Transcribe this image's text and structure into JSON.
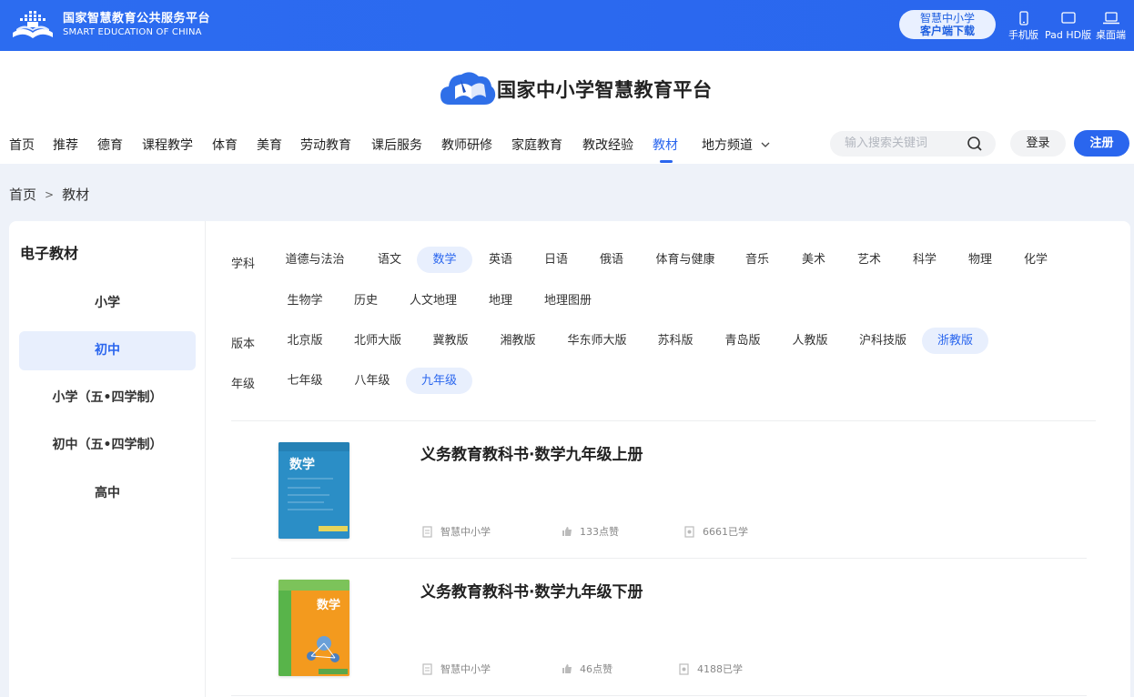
{
  "topbar": {
    "brand_cn": "国家智慧教育公共服务平台",
    "brand_en": "SMART EDUCATION OF CHINA",
    "download_line1": "智慧中小学",
    "download_line2": "客户端下载",
    "devices": [
      {
        "label": "手机版",
        "icon": "phone-icon"
      },
      {
        "label": "Pad HD版",
        "icon": "tablet-icon"
      },
      {
        "label": "桌面端",
        "icon": "laptop-icon"
      }
    ]
  },
  "header": {
    "platform_title": "国家中小学智慧教育平台"
  },
  "nav": {
    "items": [
      {
        "label": "首页"
      },
      {
        "label": "推荐"
      },
      {
        "label": "德育"
      },
      {
        "label": "课程教学"
      },
      {
        "label": "体育"
      },
      {
        "label": "美育"
      },
      {
        "label": "劳动教育"
      },
      {
        "label": "课后服务"
      },
      {
        "label": "教师研修"
      },
      {
        "label": "家庭教育"
      },
      {
        "label": "教改经验"
      },
      {
        "label": "教材"
      },
      {
        "label": "地方频道"
      }
    ],
    "active": "教材"
  },
  "search": {
    "placeholder": "输入搜索关键词"
  },
  "auth": {
    "login": "登录",
    "register": "注册"
  },
  "breadcrumb": {
    "home": "首页",
    "sep": ">",
    "current": "教材"
  },
  "sidebar": {
    "title": "电子教材",
    "items": [
      {
        "label": "小学"
      },
      {
        "label": "初中"
      },
      {
        "label": "小学（五•四学制）"
      },
      {
        "label": "初中（五•四学制）"
      },
      {
        "label": "高中"
      }
    ],
    "active": "初中"
  },
  "filters": {
    "subject_label": "学科",
    "subjects_row1": [
      "道德与法治",
      "语文",
      "数学",
      "英语",
      "日语",
      "俄语",
      "体育与健康",
      "音乐",
      "美术",
      "艺术",
      "科学",
      "物理",
      "化学"
    ],
    "subjects_row2": [
      "生物学",
      "历史",
      "人文地理",
      "地理",
      "地理图册"
    ],
    "subject_active": "数学",
    "edition_label": "版本",
    "editions": [
      "北京版",
      "北师大版",
      "冀教版",
      "湘教版",
      "华东师大版",
      "苏科版",
      "青岛版",
      "人教版",
      "沪科技版",
      "浙教版"
    ],
    "edition_active": "浙教版",
    "grade_label": "年级",
    "grades": [
      "七年级",
      "八年级",
      "九年级"
    ],
    "grade_active": "九年级"
  },
  "books": [
    {
      "title": "义务教育教科书·数学九年级上册",
      "publisher": "智慧中小学",
      "likes": "133点赞",
      "learners": "6661已学",
      "cover_text": "数学",
      "cover_color": "#2a8fc4"
    },
    {
      "title": "义务教育教科书·数学九年级下册",
      "publisher": "智慧中小学",
      "likes": "46点赞",
      "learners": "4188已学",
      "cover_text": "数学",
      "cover_color": "#f39a1e"
    }
  ],
  "colors": {
    "primary": "#2a66ee",
    "active_bg": "#e8effd",
    "page_bg": "#eef2f9"
  }
}
